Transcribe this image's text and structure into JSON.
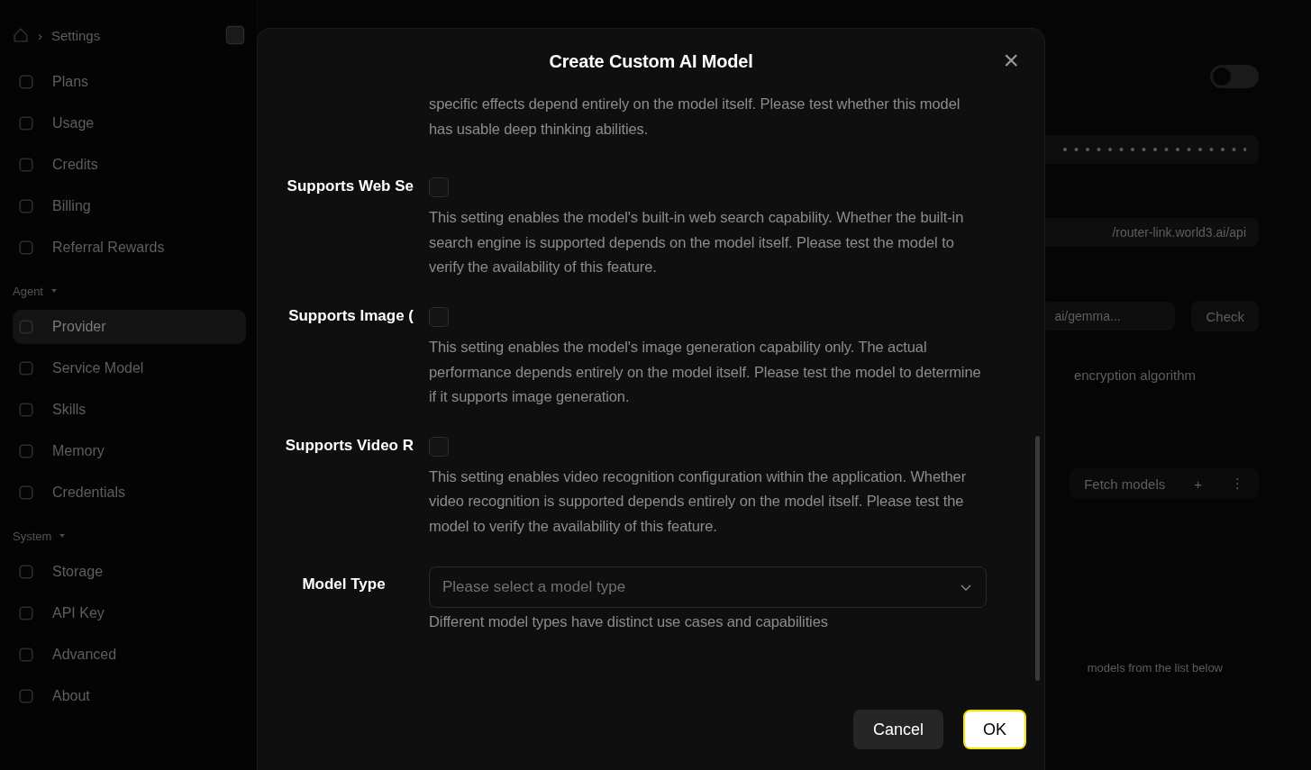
{
  "breadcrumb": {
    "current": "Settings",
    "separator": "›"
  },
  "sidebar": {
    "sections": [
      {
        "items": [
          {
            "label": "Plans",
            "selected": false
          },
          {
            "label": "Usage",
            "selected": false
          },
          {
            "label": "Credits",
            "selected": false
          },
          {
            "label": "Billing",
            "selected": false
          },
          {
            "label": "Referral Rewards",
            "selected": false
          }
        ]
      },
      {
        "title": "Agent",
        "items": [
          {
            "label": "Provider",
            "selected": true
          },
          {
            "label": "Service Model",
            "selected": false
          },
          {
            "label": "Skills",
            "selected": false
          },
          {
            "label": "Memory",
            "selected": false
          },
          {
            "label": "Credentials",
            "selected": false
          }
        ]
      },
      {
        "title": "System",
        "items": [
          {
            "label": "Storage",
            "selected": false
          },
          {
            "label": "API Key",
            "selected": false
          },
          {
            "label": "Advanced",
            "selected": false
          },
          {
            "label": "About",
            "selected": false
          }
        ]
      }
    ]
  },
  "background": {
    "toggle_on": false,
    "url_value": "/router-link.world3.ai/api",
    "model_value": "ai/gemma...",
    "check_button": "Check",
    "encryption_note": "encryption algorithm",
    "fetch_button": "Fetch models",
    "add_button": "+",
    "more_button": "⋮",
    "list_hint": "models from the list below"
  },
  "dialog": {
    "title": "Create Custom AI Model",
    "close": "×",
    "rows": [
      {
        "kind": "note",
        "text": "specific effects depend entirely on the model itself. Please test whether this model has usable deep thinking abilities."
      },
      {
        "kind": "checkbox",
        "label": "Supports Web Se",
        "checked": false,
        "text": "This setting enables the model's built-in web search capability. Whether the built-in search engine is supported depends on the model itself. Please test the model to verify the availability of this feature."
      },
      {
        "kind": "checkbox",
        "label": "Supports Image (",
        "checked": false,
        "text": "This setting enables the model's image generation capability only. The actual performance depends entirely on the model itself. Please test the model to determine if it supports image generation."
      },
      {
        "kind": "checkbox",
        "label": "Supports Video R",
        "checked": false,
        "text": "This setting enables video recognition configuration within the application. Whether video recognition is supported depends entirely on the model itself. Please test the model to verify the availability of this feature."
      },
      {
        "kind": "select",
        "label": "Model Type",
        "placeholder": "Please select a model type",
        "text": "Different model types have distinct use cases and capabilities"
      }
    ],
    "buttons": [
      {
        "label": "Cancel",
        "kind": "secondary",
        "focused": false
      },
      {
        "label": "OK",
        "kind": "primary",
        "focused": true
      }
    ]
  }
}
